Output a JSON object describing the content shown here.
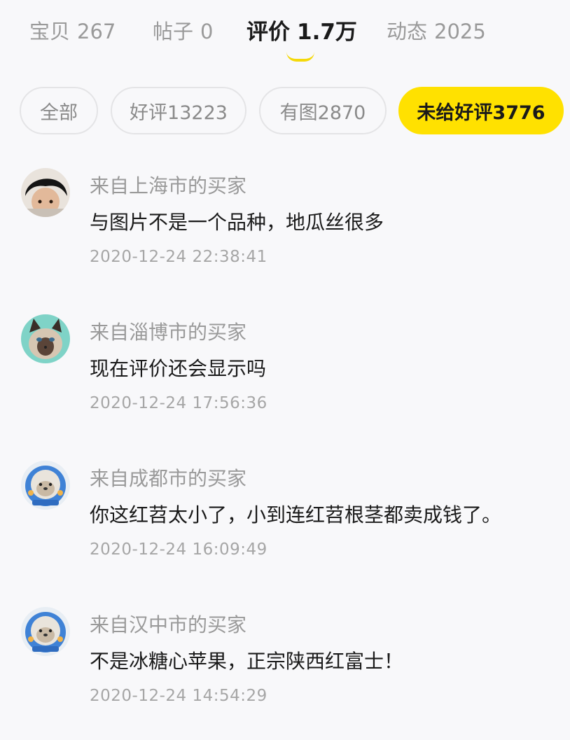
{
  "tabs": [
    {
      "label": "宝贝",
      "count": "267"
    },
    {
      "label": "帖子",
      "count": "0"
    },
    {
      "label": "评价",
      "count": "1.7万"
    },
    {
      "label": "动态",
      "count": "2025"
    }
  ],
  "active_tab": "评价",
  "filters": [
    {
      "label": "全部"
    },
    {
      "label": "好评13223"
    },
    {
      "label": "有图2870"
    },
    {
      "label": "未给好评3776"
    }
  ],
  "active_filter": "未给好评3776",
  "colors": {
    "accent": "#ffe100",
    "underline": "#f5d90a",
    "muted": "#9a9a9a",
    "background": "#f8f8fa"
  },
  "comments": [
    {
      "user": "来自上海市的买家",
      "text": "与图片不是一个品种，地瓜丝很多",
      "time": "2020-12-24 22:38:41",
      "avatar": "child-photo-avatar"
    },
    {
      "user": "来自淄博市的买家",
      "text": "现在评价还会显示吗",
      "time": "2020-12-24 17:56:36",
      "avatar": "cat-photo-avatar"
    },
    {
      "user": "来自成都市的买家",
      "text": "你这红苕太小了，小到连红苕根茎都卖成钱了。",
      "time": "2020-12-24 16:09:49",
      "avatar": "astronaut-seal-avatar"
    },
    {
      "user": "来自汉中市的买家",
      "text": "不是冰糖心苹果，正宗陕西红富士！",
      "time": "2020-12-24 14:54:29",
      "avatar": "astronaut-seal-avatar"
    }
  ]
}
